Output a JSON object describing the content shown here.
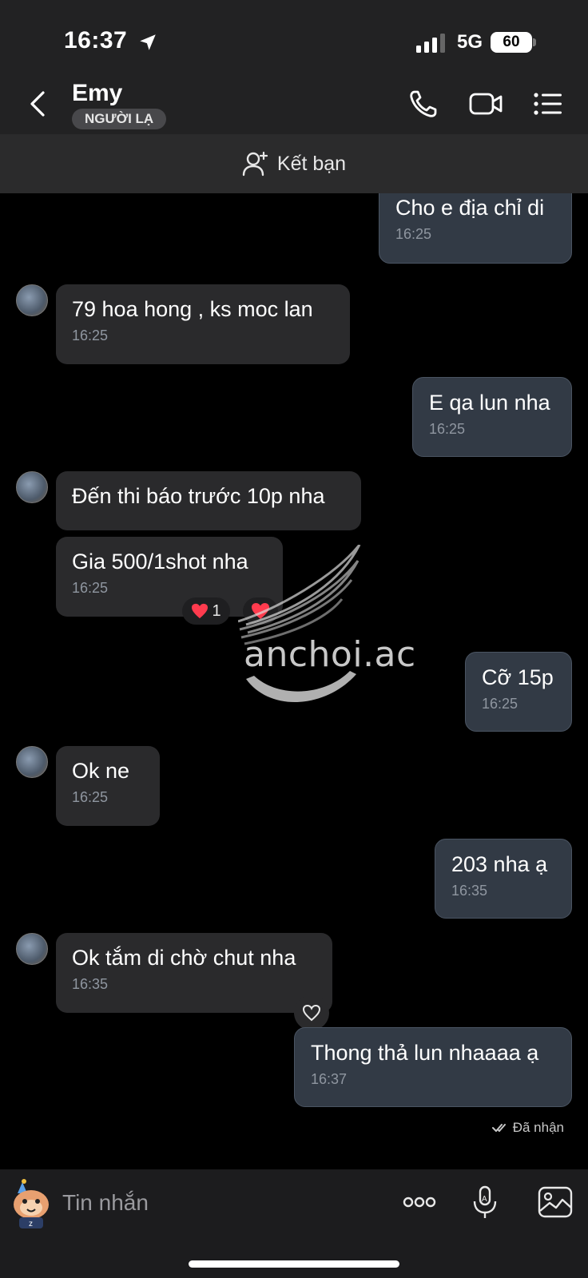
{
  "status_bar": {
    "time": "16:37",
    "network": "5G",
    "battery": "60"
  },
  "header": {
    "contact_name": "Emy",
    "badge": "NGƯỜI LẠ",
    "icons": [
      "back-icon",
      "phone-icon",
      "video-call-icon",
      "menu-icon"
    ]
  },
  "add_friend": {
    "label": "Kết bạn",
    "icon": "add-user-icon"
  },
  "messages": [
    {
      "from": "me",
      "text": "Cho e địa chỉ di",
      "time": "16:25"
    },
    {
      "from": "Emy",
      "text": "79 hoa hong , ks moc lan",
      "time": "16:25"
    },
    {
      "from": "me",
      "text": "E qa lun nha",
      "time": "16:25"
    },
    {
      "from": "Emy",
      "text": "Đến thi báo trước 10p nha",
      "time": ""
    },
    {
      "from": "Emy",
      "text": "Gia 500/1shot nha",
      "time": "16:25",
      "reaction_count": "1"
    },
    {
      "from": "me",
      "text": "Cỡ 15p",
      "time": "16:25"
    },
    {
      "from": "Emy",
      "text": "Ok ne",
      "time": "16:25"
    },
    {
      "from": "me",
      "text": "203 nha ạ",
      "time": "16:35"
    },
    {
      "from": "Emy",
      "text": "Ok tắm di chờ chut nha",
      "time": "16:35"
    },
    {
      "from": "me",
      "text": "Thong thả lun nhaaaa ạ",
      "time": "16:37"
    }
  ],
  "delivery_status": "Đã nhận",
  "watermark": "anchoi.ac",
  "composer": {
    "placeholder": "Tin nhắn",
    "icons": [
      "sticker-icon",
      "more-icon",
      "voice-icon",
      "image-icon"
    ]
  },
  "colors": {
    "incoming_bubble": "#2a2a2c",
    "outgoing_bubble": "#323a45",
    "background": "#000000",
    "reaction_heart": "#ff3b4e"
  }
}
